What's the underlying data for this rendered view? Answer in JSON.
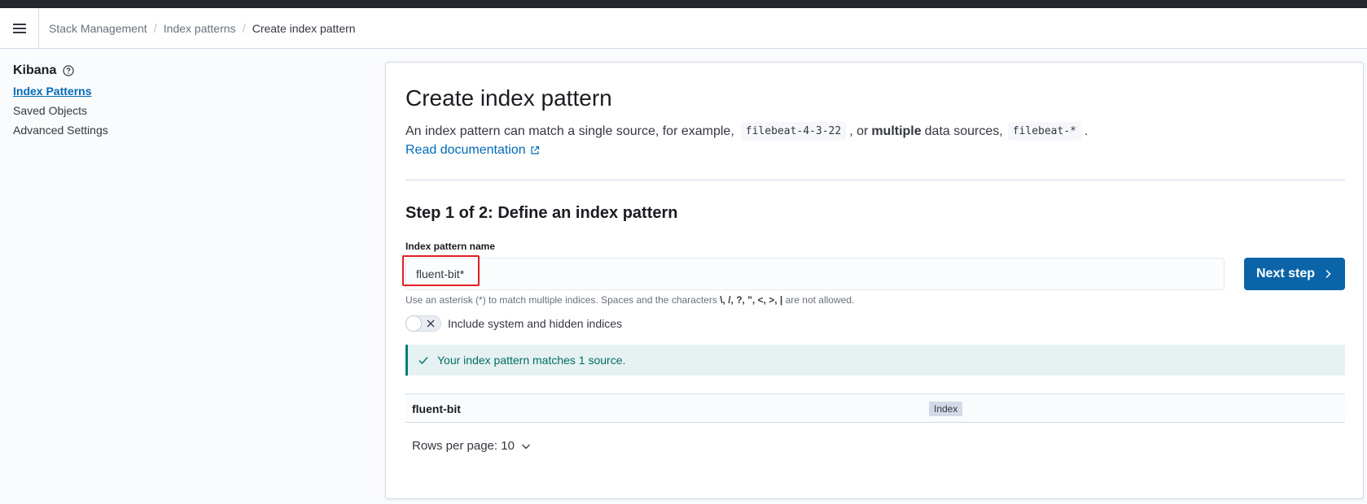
{
  "breadcrumbs": {
    "items": [
      "Stack Management",
      "Index patterns"
    ],
    "current": "Create index pattern",
    "separator": "/"
  },
  "sidebar": {
    "title": "Kibana",
    "items": [
      {
        "label": "Index Patterns",
        "active": true
      },
      {
        "label": "Saved Objects",
        "active": false
      },
      {
        "label": "Advanced Settings",
        "active": false
      }
    ]
  },
  "main": {
    "title": "Create index pattern",
    "description": {
      "part1": "An index pattern can match a single source, for example,",
      "code1": "filebeat-4-3-22",
      "part2": ", or",
      "bold": "multiple",
      "part3": "data sources,",
      "code2": "filebeat-*",
      "part4": "."
    },
    "doc_link": "Read documentation",
    "step_title": "Step 1 of 2: Define an index pattern",
    "field_label": "Index pattern name",
    "field_value": "fluent-bit*",
    "next_button": "Next step",
    "help_text": {
      "prefix": "Use an asterisk (*) to match multiple indices. Spaces and the characters",
      "chars": "\\, /, ?, \", <, >, |",
      "suffix": "are not allowed."
    },
    "toggle_label": "Include system and hidden indices",
    "toggle_on": false,
    "callout": "Your index pattern matches 1 source.",
    "table": {
      "rows": [
        {
          "name": "fluent-bit",
          "type": "Index"
        }
      ]
    },
    "rows_per_page": "Rows per page: 10"
  },
  "colors": {
    "accent": "#006bb8",
    "primary_button": "#0b64a8",
    "success": "#017d73",
    "highlight": "#e02020"
  }
}
